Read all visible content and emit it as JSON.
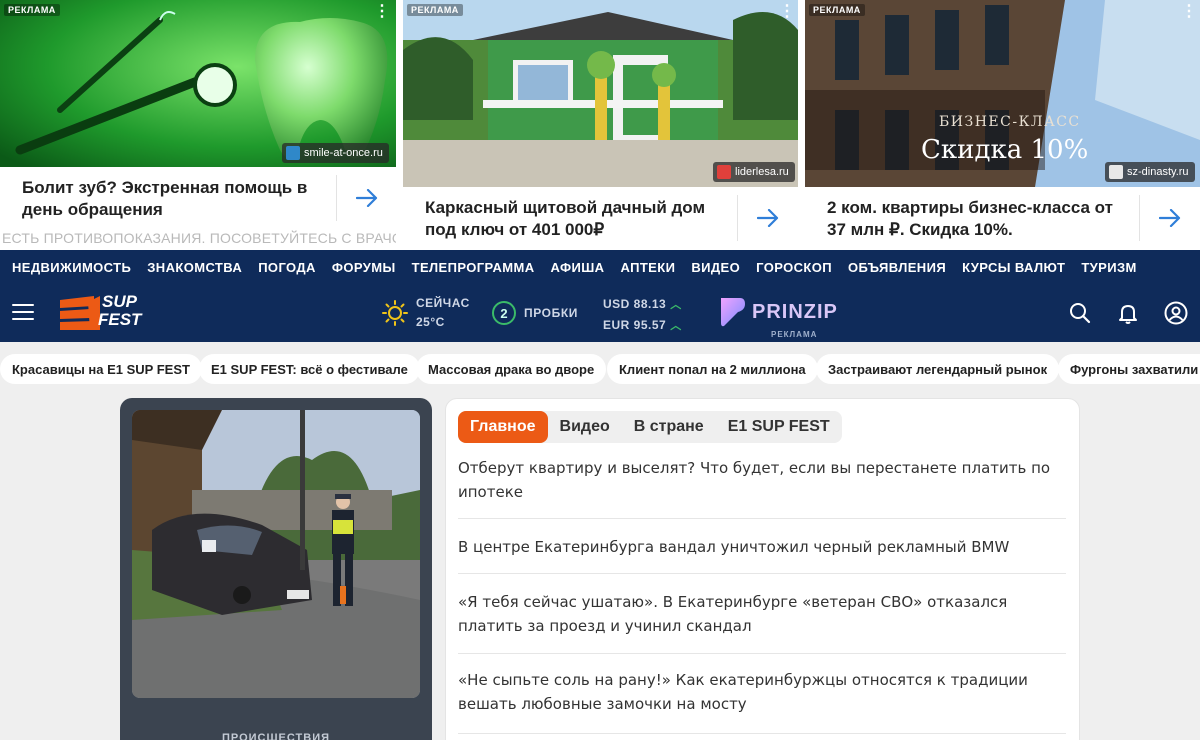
{
  "ads": [
    {
      "label": "РЕКЛАМА",
      "domain": "smile-at-once.ru",
      "text": "Болит зуб? Экстренная помощь в день обращения",
      "warning": "ЕСТЬ ПРОТИВОПОКАЗАНИЯ. ПОСОВЕТУЙТЕСЬ С ВРАЧОМ"
    },
    {
      "label": "РЕКЛАМА",
      "domain": "liderlesa.ru",
      "text": "Каркасный щитовой дачный дом под ключ от 401 000₽"
    },
    {
      "label": "РЕКЛАМА",
      "domain": "sz-dinasty.ru",
      "image_caption_top": "БИЗНЕС-КЛАСС",
      "image_caption_main": "Скидка 10%",
      "text": "2 ком. квартиры бизнес-класса от 37 млн ₽. Скидка 10%."
    }
  ],
  "topnav": [
    "НЕДВИЖИМОСТЬ",
    "ЗНАКОМСТВА",
    "ПОГОДА",
    "ФОРУМЫ",
    "ТЕЛЕПРОГРАММА",
    "АФИША",
    "АПТЕКИ",
    "ВИДЕО",
    "ГОРОСКОП",
    "ОБЪЯВЛЕНИЯ",
    "КУРСЫ ВАЛЮТ",
    "ТУРИЗМ"
  ],
  "header": {
    "logo_text_1": "SUP",
    "logo_text_2": "FEST",
    "weather_label": "СЕЙЧАС",
    "weather_temp": "25°C",
    "traffic_score": "2",
    "traffic_label": "ПРОБКИ",
    "usd": "USD 88.13",
    "eur": "EUR 95.57",
    "partner": "PRINZIP",
    "partner_ad": "РЕКЛАМА"
  },
  "pills": [
    "Красавицы на E1 SUP FEST",
    "E1 SUP FEST: всё о фестивале",
    "Массовая драка во дворе",
    "Клиент попал на 2 миллиона",
    "Застраивают легендарный рынок",
    "Фургоны захватили п"
  ],
  "featured": {
    "category": "ПРОИСШЕСТВИЯ"
  },
  "news": {
    "tabs": [
      "Главное",
      "Видео",
      "В стране",
      "E1 SUP FEST"
    ],
    "items": [
      "Отберут квартиру и выселят? Что будет, если вы перестанете платить по ипотеке",
      "В центре Екатеринбурга вандал уничтожил черный рекламный BMW",
      "«Я тебя сейчас ушатаю». В Екатеринбурге «ветеран СВО» отказался платить за проезд и учинил скандал",
      "«Не сыпьте соль на рану!» Как екатеринбуржцы относятся к традиции вешать любовные замочки на мосту"
    ]
  },
  "colors": {
    "navy": "#0f2b5a",
    "accent_orange": "#ec5a15",
    "traffic_green": "#3bbb69",
    "link_blue": "#2f7ed8"
  }
}
